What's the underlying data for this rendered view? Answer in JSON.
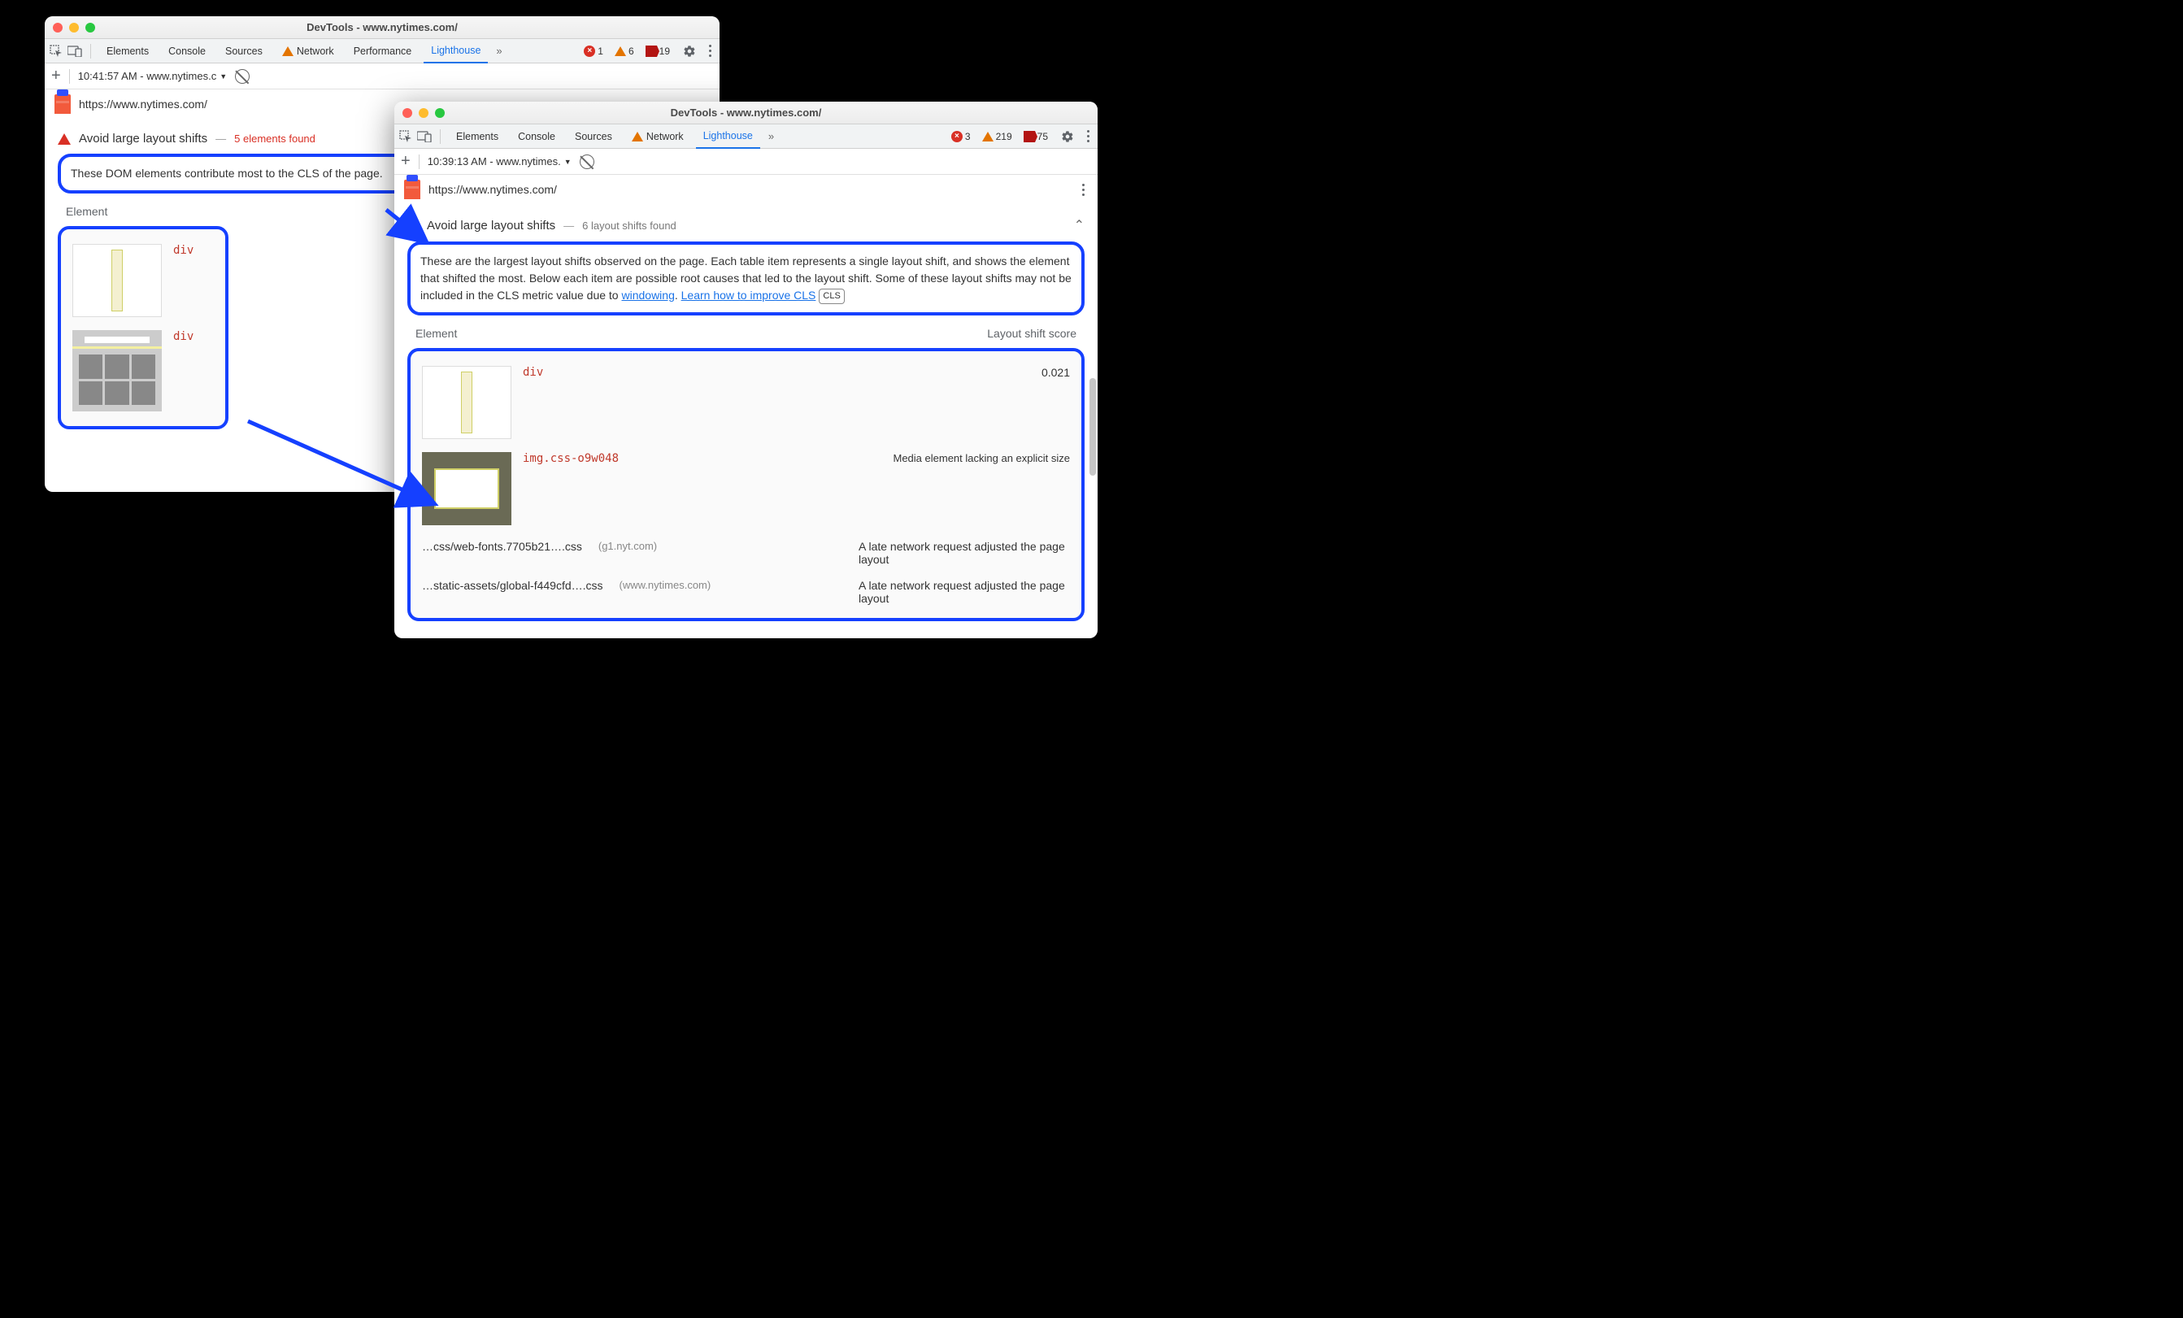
{
  "left": {
    "title": "DevTools - www.nytimes.com/",
    "tabs": [
      "Elements",
      "Console",
      "Sources",
      "Network",
      "Performance",
      "Lighthouse"
    ],
    "activeTab": "Lighthouse",
    "errors": "1",
    "warnings": "6",
    "issues": "19",
    "sub_time": "10:41:57 AM - www.nytimes.c",
    "url": "https://www.nytimes.com/",
    "audit_title": "Avoid large layout shifts",
    "audit_count": "5 elements found",
    "desc": "These DOM elements contribute most to the CLS of the page.",
    "col_element": "Element",
    "rows": [
      {
        "code": "div"
      },
      {
        "code": "div"
      }
    ]
  },
  "right": {
    "title": "DevTools - www.nytimes.com/",
    "tabs": [
      "Elements",
      "Console",
      "Sources",
      "Network",
      "Lighthouse"
    ],
    "activeTab": "Lighthouse",
    "errors": "3",
    "warnings": "219",
    "issues": "75",
    "sub_time": "10:39:13 AM - www.nytimes.",
    "url": "https://www.nytimes.com/",
    "audit_title": "Avoid large layout shifts",
    "audit_count": "6 layout shifts found",
    "desc_1": "These are the largest layout shifts observed on the page. Each table item represents a single layout shift, and shows the element that shifted the most. Below each item are possible root causes that led to the layout shift. Some of these layout shifts may not be included in the CLS metric value due to ",
    "link1": "windowing",
    "sep": ". ",
    "link2": "Learn how to improve CLS",
    "cls_tag": "CLS",
    "col_element": "Element",
    "col_score": "Layout shift score",
    "row1_code": "div",
    "row1_score": "0.021",
    "row2_code": "img.css-o9w048",
    "row2_reason": "Media element lacking an explicit size",
    "cause1_file": "…css/web-fonts.7705b21….css",
    "cause1_domain": "(g1.nyt.com)",
    "cause1_reason": "A late network request adjusted the page layout",
    "cause2_file": "…static-assets/global-f449cfd….css",
    "cause2_domain": "(www.nytimes.com)",
    "cause2_reason": "A late network request adjusted the page layout"
  }
}
